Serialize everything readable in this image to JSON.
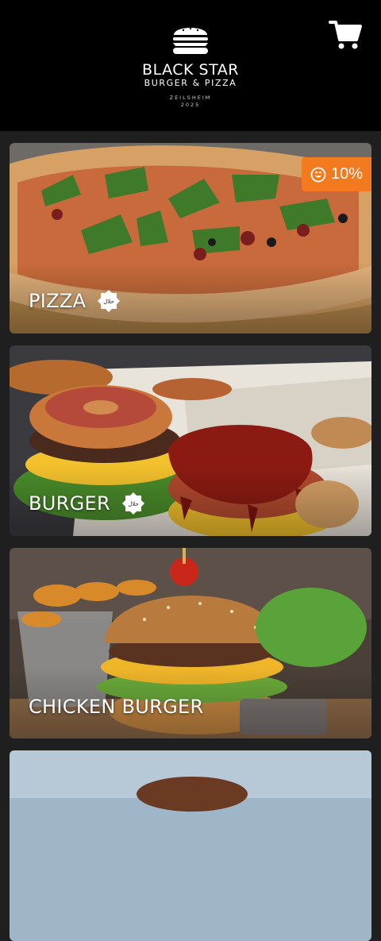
{
  "header": {
    "brand_name": "BLACK STAR",
    "brand_tagline": "BURGER & PIZZA",
    "brand_location": "ZEILSHEIM",
    "brand_year": "2025",
    "cart_icon": "shopping-cart-icon"
  },
  "categories": [
    {
      "title": "PIZZA",
      "halal": true,
      "discount": "10%",
      "halal_text": "حلال"
    },
    {
      "title": "BURGER",
      "halal": true,
      "halal_text": "حلال"
    },
    {
      "title": "CHICKEN BURGER",
      "halal": false
    },
    {
      "title": "",
      "halal": false
    }
  ],
  "colors": {
    "header_bg": "#000000",
    "page_bg": "#1f1f1f",
    "discount_badge": "#f47a1f"
  }
}
